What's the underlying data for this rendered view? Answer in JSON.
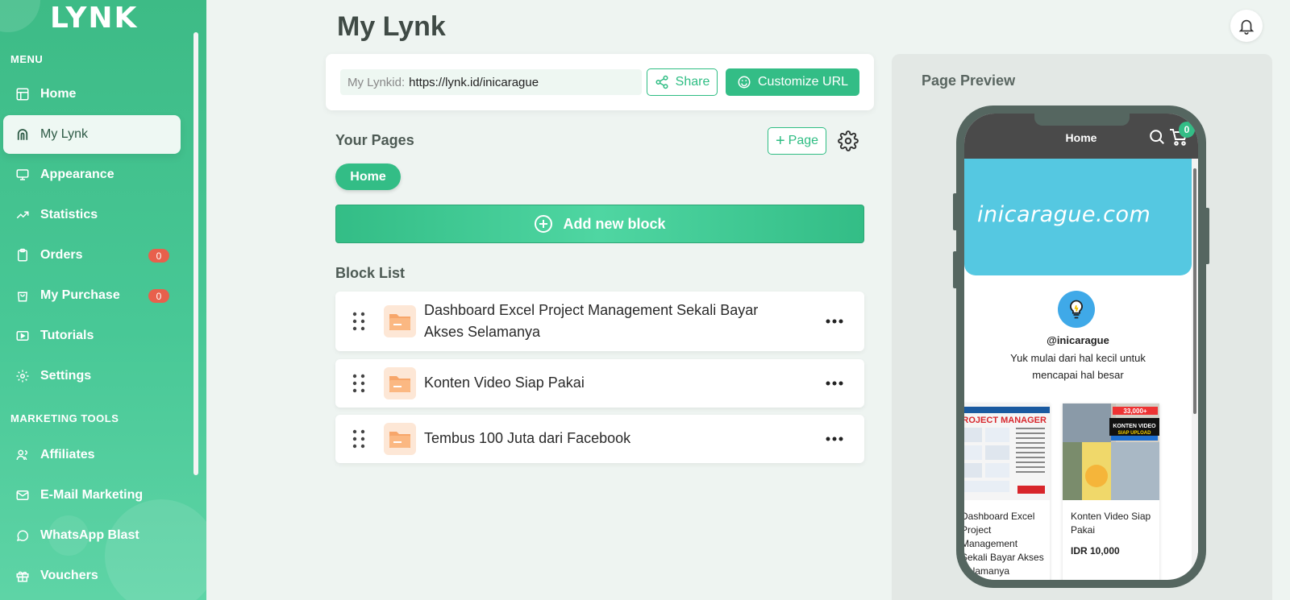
{
  "brand": {
    "logo": "LYNK"
  },
  "sidebar": {
    "menu_title": "MENU",
    "marketing_title": "MARKETING TOOLS",
    "items": [
      {
        "label": "Home",
        "icon": "layout-icon"
      },
      {
        "label": "My Lynk",
        "icon": "arch-icon"
      },
      {
        "label": "Appearance",
        "icon": "monitor-icon"
      },
      {
        "label": "Statistics",
        "icon": "trend-icon"
      },
      {
        "label": "Orders",
        "icon": "clipboard-icon",
        "badge": "0"
      },
      {
        "label": "My Purchase",
        "icon": "bag-icon",
        "badge": "0"
      },
      {
        "label": "Tutorials",
        "icon": "play-icon"
      },
      {
        "label": "Settings",
        "icon": "gear-icon"
      }
    ],
    "marketing_items": [
      {
        "label": "Affiliates",
        "icon": "users-icon"
      },
      {
        "label": "E-Mail Marketing",
        "icon": "mail-icon"
      },
      {
        "label": "WhatsApp Blast",
        "icon": "whatsapp-icon"
      },
      {
        "label": "Vouchers",
        "icon": "gift-icon"
      }
    ]
  },
  "header": {
    "title": "My Lynk"
  },
  "url_card": {
    "label": "My Lynkid:",
    "url": "https://lynk.id/inicarague",
    "share_label": "Share",
    "customize_label": "Customize URL"
  },
  "pages": {
    "title": "Your Pages",
    "add_page_label": "Page",
    "tabs": [
      "Home"
    ]
  },
  "add_block_label": "Add new block",
  "block_list": {
    "title": "Block List",
    "items": [
      "Dashboard Excel Project Management Sekali Bayar Akses Selamanya",
      "Konten Video Siap Pakai",
      "Tembus 100 Juta dari Facebook"
    ]
  },
  "preview": {
    "title": "Page Preview",
    "screen_title": "Home",
    "cart_count": "0",
    "banner_text": "inicarague.com",
    "handle": "@inicarague",
    "bio": "Yuk mulai dari hal kecil untuk mencapai hal besar",
    "products": [
      {
        "name": "Dashboard Excel Project Management Sekali Bayar Akses Selamanya",
        "price": "",
        "img_text": "PROJECT MANAGER"
      },
      {
        "name": "Konten Video Siap Pakai",
        "price": "IDR 10,000",
        "img_text": "KONTEN VIDEO"
      }
    ]
  },
  "colors": {
    "accent": "#33bd86",
    "badge": "#e8604c",
    "banner": "#55c8e1"
  }
}
